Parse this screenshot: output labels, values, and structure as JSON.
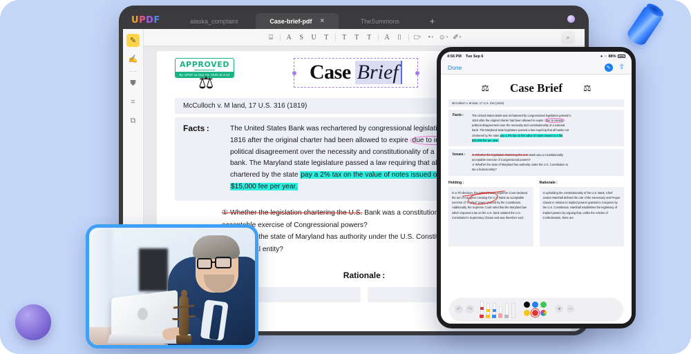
{
  "app": {
    "logo": "UPDF",
    "tabs": [
      {
        "label": "alaska_complaint",
        "active": false
      },
      {
        "label": "Case-brief-pdf",
        "active": true,
        "close": "×"
      },
      {
        "label": "TheSummons",
        "active": false
      }
    ],
    "add_tab": "+",
    "sidebar": [
      {
        "name": "annotate-tool",
        "glyph": "✎",
        "active": true
      },
      {
        "name": "edit-pdf-tool",
        "glyph": "✍",
        "active": false
      },
      {
        "name": "stamp-tool",
        "glyph": "⛊",
        "active": false
      },
      {
        "name": "crop-tool",
        "glyph": "⌗",
        "active": false
      },
      {
        "name": "pages-tool",
        "glyph": "⧉",
        "active": false
      }
    ],
    "toolbar": [
      {
        "name": "sticky-note-icon",
        "glyph": "⌸"
      },
      {
        "name": "highlight-icon",
        "glyph": "A"
      },
      {
        "name": "strikethrough-icon",
        "glyph": "S"
      },
      {
        "name": "underline-icon",
        "glyph": "U"
      },
      {
        "name": "squiggly-icon",
        "glyph": "T"
      },
      {
        "name": "text-icon",
        "glyph": "T"
      },
      {
        "name": "text-box-icon",
        "glyph": "T"
      },
      {
        "name": "text-callout-icon",
        "glyph": "T"
      },
      {
        "name": "pencil-icon",
        "glyph": "A"
      },
      {
        "name": "eraser-icon",
        "glyph": "⌷"
      },
      {
        "name": "shape-icon",
        "glyph": "□",
        "caret": "▾"
      },
      {
        "name": "ink-icon",
        "glyph": "◔",
        "caret": "▾"
      },
      {
        "name": "stamp-menu-icon",
        "glyph": "☺",
        "caret": "▾"
      },
      {
        "name": "signature-icon",
        "glyph": "✐",
        "caret": "▾"
      }
    ],
    "search_icon": "⌕"
  },
  "document": {
    "stamp": {
      "word": "APPROVED",
      "subtext": "By UPDF at Sep 29, 2020 at 4:44"
    },
    "title_case": "Case",
    "title_brief": "Brief",
    "citation": "McCulloch v. M land, 17 U.S. 316 (1819)",
    "facts_label": "Facts :",
    "facts_1": "The United States Bank was rechartered by congressional legislation passed in",
    "facts_2a": "1816 after the original charter had been allowed to expire ",
    "facts_2b": "due to intense",
    "facts_3": "political disagreement over the necessity and constitutionality of a national",
    "facts_4": "bank. The Maryland state legislature passed a law requiring that all banks not",
    "facts_5a": "chartered by the state ",
    "facts_5b": "pay a 2% tax on the value of notes issued or a flat",
    "facts_6": "$15,000 fee per year.",
    "issue_1a": "① Whether the legislation chartering the U.S.",
    "issue_1b": " Bank was a constitutionally",
    "issue_2": "acceptable exercise of Congressional powers?",
    "issue_3": "② Whether the state of Maryland has authority under the U.S. Constitution to",
    "issue_4": "tax a federal entity?",
    "rationale_label": "Rationale :"
  },
  "ipad": {
    "status": {
      "time": "4:56 PM",
      "date": "Tue Sep 6",
      "wifi": "●",
      "lock": "○",
      "battery_pct": "88%"
    },
    "nav": {
      "done": "Done",
      "markup_icon": "✎",
      "share_icon": "⇧"
    },
    "doc": {
      "title": "Case Brief",
      "scale_icon": "⚖",
      "citation": "McCulloch v. M land, 17 U.S. 316 (1819)",
      "facts_label": "Facts :",
      "facts_1": "The United States Bank was rechartered by congressional legislation passed in",
      "facts_2a": "1816 after the original charter had been allowed to expire ",
      "facts_2b": "due to intense",
      "facts_3": "political disagreement over the necessity and constitutionality of a national",
      "facts_4": "bank. The Maryland state legislature passed a law requiring that all banks not",
      "facts_5a": "chartered by the state ",
      "facts_5b": "pay a 2% tax on the value of notes issued or a flat",
      "facts_6": "$15,000 fee per year.",
      "issues_label": "Issues :",
      "issue_1a": "① Whether the legislation chartering the U.S.",
      "issue_1b": " Bank was a constitutionally",
      "issue_2": "acceptable exercise of Congressional powers?",
      "issue_3": "② Whether the state of Maryland has authority under the U.S. Constitution to",
      "issue_4": "tax a federal entity?",
      "holding_label": "Holding :",
      "holding_body": "In a 7/0 decision, the United States Supreme Court declared the act of Congress creating the U.S. Bank an acceptable exercise of \"implied\" power granted by the Constitution. Additionally, the Supreme Court ruled that the Maryland law which imposed a tax on the U.S. bank violated the U.S. Constitution's Supremacy Clause and was therefore void.",
      "rationale_label": "Rationale :",
      "rationale_body": "In upholding the constitutionality of the U.S. Bank, Chief Justice Marshall defined the role of the Necessary and Proper Clause in relation to implied powers granted to Congress by the U.S. Constitution. Marshall establishes the legitimacy of implied powers by arguing that, unlike the Articles of Confederation, there are"
    },
    "markup_toolbar": {
      "undo_icon": "↶",
      "redo_icon": "↷",
      "pens": [
        {
          "name": "marker-pen",
          "color": "#e03434"
        },
        {
          "name": "highlighter-pen",
          "color": "#f5c518"
        },
        {
          "name": "fountain-pen",
          "color": "#3a8df5"
        },
        {
          "name": "eraser-tool",
          "color": "#f0a0a0"
        },
        {
          "name": "pencil-tool",
          "color": "#9a9aa0"
        },
        {
          "name": "ruler-tool",
          "color": "#d8d8dc"
        }
      ],
      "colors": [
        "#0b0b0d",
        "#2a7cf5",
        "#3fc45a",
        "#f5c518",
        "#e03434",
        "rainbow"
      ],
      "selected_color": "#e03434",
      "add_icon": "✦",
      "more_icon": "⋯"
    }
  },
  "theme": {
    "background": "#c3d6f8",
    "accent_blue": "#3fa0f5",
    "highlight_cyan": "#2ef0e0",
    "stamp_green": "#19b383",
    "selection_purple": "#a37ce6"
  }
}
